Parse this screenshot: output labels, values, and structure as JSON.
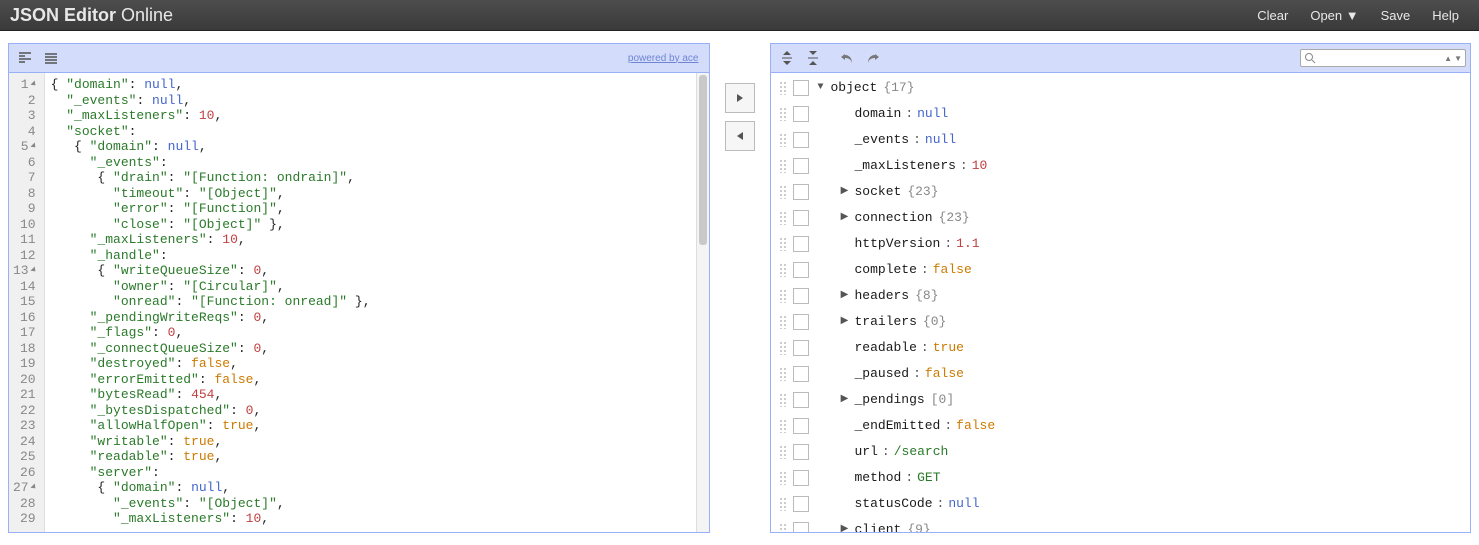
{
  "header": {
    "brand_bold": "JSON Editor",
    "brand_light": "Online",
    "menu": [
      "Clear",
      "Open ▼",
      "Save",
      "Help"
    ]
  },
  "left": {
    "powered": "powered by ace",
    "code": [
      {
        "n": 1,
        "fold": true,
        "h": "{ \"domain\": null,",
        "t": [
          [
            "p",
            "{ "
          ],
          [
            "k",
            "\"domain\""
          ],
          [
            "p",
            ": "
          ],
          [
            "nl",
            "null"
          ],
          [
            "p",
            ","
          ]
        ]
      },
      {
        "n": 2,
        "h": "  \"_events\": null,",
        "t": [
          [
            "p",
            "  "
          ],
          [
            "k",
            "\"_events\""
          ],
          [
            "p",
            ": "
          ],
          [
            "nl",
            "null"
          ],
          [
            "p",
            ","
          ]
        ]
      },
      {
        "n": 3,
        "h": "  \"_maxListeners\": 10,",
        "t": [
          [
            "p",
            "  "
          ],
          [
            "k",
            "\"_maxListeners\""
          ],
          [
            "p",
            ": "
          ],
          [
            "n",
            "10"
          ],
          [
            "p",
            ","
          ]
        ]
      },
      {
        "n": 4,
        "h": "  \"socket\":",
        "t": [
          [
            "p",
            "  "
          ],
          [
            "k",
            "\"socket\""
          ],
          [
            "p",
            ":"
          ]
        ]
      },
      {
        "n": 5,
        "fold": true,
        "h": "   { \"domain\": null,",
        "t": [
          [
            "p",
            "   { "
          ],
          [
            "k",
            "\"domain\""
          ],
          [
            "p",
            ": "
          ],
          [
            "nl",
            "null"
          ],
          [
            "p",
            ","
          ]
        ]
      },
      {
        "n": 6,
        "h": "     \"_events\":",
        "t": [
          [
            "p",
            "     "
          ],
          [
            "k",
            "\"_events\""
          ],
          [
            "p",
            ":"
          ]
        ]
      },
      {
        "n": 7,
        "h": "      { \"drain\": \"[Function: ondrain]\",",
        "t": [
          [
            "p",
            "      { "
          ],
          [
            "k",
            "\"drain\""
          ],
          [
            "p",
            ": "
          ],
          [
            "s",
            "\"[Function: ondrain]\""
          ],
          [
            "p",
            ","
          ]
        ]
      },
      {
        "n": 8,
        "h": "        \"timeout\": \"[Object]\",",
        "t": [
          [
            "p",
            "        "
          ],
          [
            "k",
            "\"timeout\""
          ],
          [
            "p",
            ": "
          ],
          [
            "s",
            "\"[Object]\""
          ],
          [
            "p",
            ","
          ]
        ]
      },
      {
        "n": 9,
        "h": "        \"error\": \"[Function]\",",
        "t": [
          [
            "p",
            "        "
          ],
          [
            "k",
            "\"error\""
          ],
          [
            "p",
            ": "
          ],
          [
            "s",
            "\"[Function]\""
          ],
          [
            "p",
            ","
          ]
        ]
      },
      {
        "n": 10,
        "h": "        \"close\": \"[Object]\" },",
        "t": [
          [
            "p",
            "        "
          ],
          [
            "k",
            "\"close\""
          ],
          [
            "p",
            ": "
          ],
          [
            "s",
            "\"[Object]\""
          ],
          [
            "p",
            " },"
          ]
        ]
      },
      {
        "n": 11,
        "h": "     \"_maxListeners\": 10,",
        "t": [
          [
            "p",
            "     "
          ],
          [
            "k",
            "\"_maxListeners\""
          ],
          [
            "p",
            ": "
          ],
          [
            "n",
            "10"
          ],
          [
            "p",
            ","
          ]
        ]
      },
      {
        "n": 12,
        "h": "     \"_handle\":",
        "t": [
          [
            "p",
            "     "
          ],
          [
            "k",
            "\"_handle\""
          ],
          [
            "p",
            ":"
          ]
        ]
      },
      {
        "n": 13,
        "fold": true,
        "h": "      { \"writeQueueSize\": 0,",
        "t": [
          [
            "p",
            "      { "
          ],
          [
            "k",
            "\"writeQueueSize\""
          ],
          [
            "p",
            ": "
          ],
          [
            "n",
            "0"
          ],
          [
            "p",
            ","
          ]
        ]
      },
      {
        "n": 14,
        "h": "        \"owner\": \"[Circular]\",",
        "t": [
          [
            "p",
            "        "
          ],
          [
            "k",
            "\"owner\""
          ],
          [
            "p",
            ": "
          ],
          [
            "s",
            "\"[Circular]\""
          ],
          [
            "p",
            ","
          ]
        ]
      },
      {
        "n": 15,
        "h": "        \"onread\": \"[Function: onread]\" },",
        "t": [
          [
            "p",
            "        "
          ],
          [
            "k",
            "\"onread\""
          ],
          [
            "p",
            ": "
          ],
          [
            "s",
            "\"[Function: onread]\""
          ],
          [
            "p",
            " },"
          ]
        ]
      },
      {
        "n": 16,
        "h": "     \"_pendingWriteReqs\": 0,",
        "t": [
          [
            "p",
            "     "
          ],
          [
            "k",
            "\"_pendingWriteReqs\""
          ],
          [
            "p",
            ": "
          ],
          [
            "n",
            "0"
          ],
          [
            "p",
            ","
          ]
        ]
      },
      {
        "n": 17,
        "h": "     \"_flags\": 0,",
        "t": [
          [
            "p",
            "     "
          ],
          [
            "k",
            "\"_flags\""
          ],
          [
            "p",
            ": "
          ],
          [
            "n",
            "0"
          ],
          [
            "p",
            ","
          ]
        ]
      },
      {
        "n": 18,
        "h": "     \"_connectQueueSize\": 0,",
        "t": [
          [
            "p",
            "     "
          ],
          [
            "k",
            "\"_connectQueueSize\""
          ],
          [
            "p",
            ": "
          ],
          [
            "n",
            "0"
          ],
          [
            "p",
            ","
          ]
        ]
      },
      {
        "n": 19,
        "h": "     \"destroyed\": false,",
        "t": [
          [
            "p",
            "     "
          ],
          [
            "k",
            "\"destroyed\""
          ],
          [
            "p",
            ": "
          ],
          [
            "b",
            "false"
          ],
          [
            "p",
            ","
          ]
        ]
      },
      {
        "n": 20,
        "h": "     \"errorEmitted\": false,",
        "t": [
          [
            "p",
            "     "
          ],
          [
            "k",
            "\"errorEmitted\""
          ],
          [
            "p",
            ": "
          ],
          [
            "b",
            "false"
          ],
          [
            "p",
            ","
          ]
        ]
      },
      {
        "n": 21,
        "h": "     \"bytesRead\": 454,",
        "t": [
          [
            "p",
            "     "
          ],
          [
            "k",
            "\"bytesRead\""
          ],
          [
            "p",
            ": "
          ],
          [
            "n",
            "454"
          ],
          [
            "p",
            ","
          ]
        ]
      },
      {
        "n": 22,
        "h": "     \"_bytesDispatched\": 0,",
        "t": [
          [
            "p",
            "     "
          ],
          [
            "k",
            "\"_bytesDispatched\""
          ],
          [
            "p",
            ": "
          ],
          [
            "n",
            "0"
          ],
          [
            "p",
            ","
          ]
        ]
      },
      {
        "n": 23,
        "h": "     \"allowHalfOpen\": true,",
        "t": [
          [
            "p",
            "     "
          ],
          [
            "k",
            "\"allowHalfOpen\""
          ],
          [
            "p",
            ": "
          ],
          [
            "b",
            "true"
          ],
          [
            "p",
            ","
          ]
        ]
      },
      {
        "n": 24,
        "h": "     \"writable\": true,",
        "t": [
          [
            "p",
            "     "
          ],
          [
            "k",
            "\"writable\""
          ],
          [
            "p",
            ": "
          ],
          [
            "b",
            "true"
          ],
          [
            "p",
            ","
          ]
        ]
      },
      {
        "n": 25,
        "h": "     \"readable\": true,",
        "t": [
          [
            "p",
            "     "
          ],
          [
            "k",
            "\"readable\""
          ],
          [
            "p",
            ": "
          ],
          [
            "b",
            "true"
          ],
          [
            "p",
            ","
          ]
        ]
      },
      {
        "n": 26,
        "h": "     \"server\":",
        "t": [
          [
            "p",
            "     "
          ],
          [
            "k",
            "\"server\""
          ],
          [
            "p",
            ":"
          ]
        ]
      },
      {
        "n": 27,
        "fold": true,
        "h": "      { \"domain\": null,",
        "t": [
          [
            "p",
            "      { "
          ],
          [
            "k",
            "\"domain\""
          ],
          [
            "p",
            ": "
          ],
          [
            "nl",
            "null"
          ],
          [
            "p",
            ","
          ]
        ]
      },
      {
        "n": 28,
        "h": "        \"_events\": \"[Object]\",",
        "t": [
          [
            "p",
            "        "
          ],
          [
            "k",
            "\"_events\""
          ],
          [
            "p",
            ": "
          ],
          [
            "s",
            "\"[Object]\""
          ],
          [
            "p",
            ","
          ]
        ]
      },
      {
        "n": 29,
        "h": "        \"_maxListeners\": 10,",
        "t": [
          [
            "p",
            "        "
          ],
          [
            "k",
            "\"_maxListeners\""
          ],
          [
            "p",
            ": "
          ],
          [
            "n",
            "10"
          ],
          [
            "p",
            ","
          ]
        ]
      }
    ]
  },
  "tree": [
    {
      "indent": 0,
      "caret": "down",
      "key": "object",
      "count": "{17}"
    },
    {
      "indent": 1,
      "key": "domain",
      "sep": ":",
      "vtype": "null",
      "val": "null"
    },
    {
      "indent": 1,
      "key": "_events",
      "sep": ":",
      "vtype": "null",
      "val": "null"
    },
    {
      "indent": 1,
      "key": "_maxListeners",
      "sep": ":",
      "vtype": "num",
      "val": "10"
    },
    {
      "indent": 1,
      "caret": "right",
      "key": "socket",
      "count": "{23}"
    },
    {
      "indent": 1,
      "caret": "right",
      "key": "connection",
      "count": "{23}"
    },
    {
      "indent": 1,
      "key": "httpVersion",
      "sep": ":",
      "vtype": "num",
      "val": "1.1"
    },
    {
      "indent": 1,
      "key": "complete",
      "sep": ":",
      "vtype": "bool",
      "val": "false"
    },
    {
      "indent": 1,
      "caret": "right",
      "key": "headers",
      "count": "{8}"
    },
    {
      "indent": 1,
      "caret": "right",
      "key": "trailers",
      "count": "{0}"
    },
    {
      "indent": 1,
      "key": "readable",
      "sep": ":",
      "vtype": "bool",
      "val": "true"
    },
    {
      "indent": 1,
      "key": "_paused",
      "sep": ":",
      "vtype": "bool",
      "val": "false"
    },
    {
      "indent": 1,
      "caret": "right",
      "key": "_pendings",
      "count": "[0]"
    },
    {
      "indent": 1,
      "key": "_endEmitted",
      "sep": ":",
      "vtype": "bool",
      "val": "false"
    },
    {
      "indent": 1,
      "key": "url",
      "sep": ":",
      "vtype": "str",
      "val": "/search"
    },
    {
      "indent": 1,
      "key": "method",
      "sep": ":",
      "vtype": "str",
      "val": "GET"
    },
    {
      "indent": 1,
      "key": "statusCode",
      "sep": ":",
      "vtype": "null",
      "val": "null"
    },
    {
      "indent": 1,
      "caret": "right",
      "key": "client",
      "count": "{9}"
    }
  ],
  "search": {
    "placeholder": ""
  }
}
